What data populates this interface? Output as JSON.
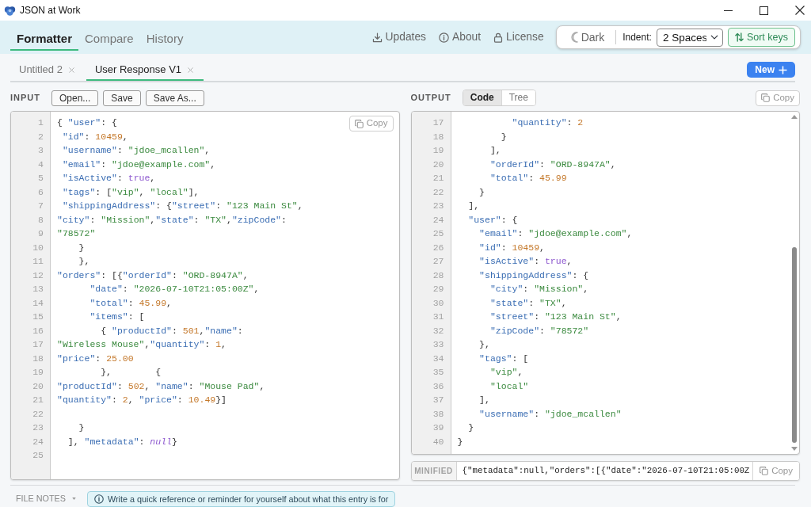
{
  "window": {
    "title": "JSON at Work"
  },
  "nav": {
    "tabs": [
      {
        "label": "Formatter",
        "selected": true
      },
      {
        "label": "Compare",
        "selected": false
      },
      {
        "label": "History",
        "selected": false
      }
    ],
    "links": [
      {
        "label": "Updates"
      },
      {
        "label": "About"
      },
      {
        "label": "License"
      }
    ]
  },
  "settings": {
    "theme_button": "Dark",
    "indent": {
      "label": "Indent:",
      "value": "2 Spaces"
    },
    "sort_keys": {
      "label": "Sort keys",
      "on": true
    }
  },
  "documents": {
    "tabs": [
      {
        "label": "Untitled 2",
        "selected": false
      },
      {
        "label": "User Response V1",
        "selected": true
      }
    ],
    "new_button": "New"
  },
  "input": {
    "label": "INPUT",
    "buttons": [
      "Open...",
      "Save",
      "Save As..."
    ],
    "copy_button": "Copy",
    "lines": [
      {
        "no": "1",
        "tokens": [
          {
            "kind": "punct",
            "text": "{ "
          },
          {
            "kind": "key",
            "text": "\"user\""
          },
          {
            "kind": "punct",
            "text": ": {"
          }
        ]
      },
      {
        "no": "2",
        "tokens": [
          {
            "kind": "key",
            "text": " \"id\""
          },
          {
            "kind": "punct",
            "text": ": "
          },
          {
            "kind": "number",
            "text": "10459"
          },
          {
            "kind": "punct",
            "text": ","
          }
        ]
      },
      {
        "no": "3",
        "tokens": [
          {
            "kind": "key",
            "text": " \"username\""
          },
          {
            "kind": "punct",
            "text": ": "
          },
          {
            "kind": "string",
            "text": "\"jdoe_mcallen\""
          },
          {
            "kind": "punct",
            "text": ","
          }
        ]
      },
      {
        "no": "4",
        "tokens": [
          {
            "kind": "key",
            "text": " \"email\""
          },
          {
            "kind": "punct",
            "text": ": "
          },
          {
            "kind": "string",
            "text": "\"jdoe@example.com\""
          },
          {
            "kind": "punct",
            "text": ","
          }
        ]
      },
      {
        "no": "5",
        "tokens": [
          {
            "kind": "key",
            "text": " \"isActive\""
          },
          {
            "kind": "punct",
            "text": ": "
          },
          {
            "kind": "bool",
            "text": "true"
          },
          {
            "kind": "punct",
            "text": ","
          }
        ]
      },
      {
        "no": "6",
        "tokens": [
          {
            "kind": "key",
            "text": " \"tags\""
          },
          {
            "kind": "punct",
            "text": ": ["
          },
          {
            "kind": "string",
            "text": "\"vip\""
          },
          {
            "kind": "punct",
            "text": ", "
          },
          {
            "kind": "string",
            "text": "\"local\""
          },
          {
            "kind": "punct",
            "text": "],"
          }
        ]
      },
      {
        "no": "7",
        "tokens": [
          {
            "kind": "key",
            "text": " \"shippingAddress\""
          },
          {
            "kind": "punct",
            "text": ": {"
          },
          {
            "kind": "key",
            "text": "\"street\""
          },
          {
            "kind": "punct",
            "text": ": "
          },
          {
            "kind": "string",
            "text": "\"123 Main St\""
          },
          {
            "kind": "punct",
            "text": ","
          }
        ]
      },
      {
        "no": "8",
        "tokens": [
          {
            "kind": "key",
            "text": "\"city\""
          },
          {
            "kind": "punct",
            "text": ": "
          },
          {
            "kind": "string",
            "text": "\"Mission\""
          },
          {
            "kind": "punct",
            "text": ","
          },
          {
            "kind": "key",
            "text": "\"state\""
          },
          {
            "kind": "punct",
            "text": ": "
          },
          {
            "kind": "string",
            "text": "\"TX\""
          },
          {
            "kind": "punct",
            "text": ","
          },
          {
            "kind": "key",
            "text": "\"zipCode\""
          },
          {
            "kind": "punct",
            "text": ":"
          }
        ]
      },
      {
        "no": "9",
        "tokens": [
          {
            "kind": "string",
            "text": "\"78572\""
          }
        ]
      },
      {
        "no": "10",
        "tokens": [
          {
            "kind": "punct",
            "text": "    }"
          }
        ]
      },
      {
        "no": "11",
        "tokens": [
          {
            "kind": "punct",
            "text": "    },"
          }
        ]
      },
      {
        "no": "12",
        "tokens": [
          {
            "kind": "key",
            "text": "\"orders\""
          },
          {
            "kind": "punct",
            "text": ": [{"
          },
          {
            "kind": "key",
            "text": "\"orderId\""
          },
          {
            "kind": "punct",
            "text": ": "
          },
          {
            "kind": "string",
            "text": "\"ORD-8947A\""
          },
          {
            "kind": "punct",
            "text": ","
          }
        ]
      },
      {
        "no": "13",
        "tokens": [
          {
            "kind": "key",
            "text": "      \"date\""
          },
          {
            "kind": "punct",
            "text": ": "
          },
          {
            "kind": "string",
            "text": "\"2026-07-10T21:05:00Z\""
          },
          {
            "kind": "punct",
            "text": ","
          }
        ]
      },
      {
        "no": "14",
        "tokens": [
          {
            "kind": "key",
            "text": "      \"total\""
          },
          {
            "kind": "punct",
            "text": ": "
          },
          {
            "kind": "number",
            "text": "45.99"
          },
          {
            "kind": "punct",
            "text": ","
          }
        ]
      },
      {
        "no": "15",
        "tokens": [
          {
            "kind": "key",
            "text": "      \"items\""
          },
          {
            "kind": "punct",
            "text": ": ["
          }
        ]
      },
      {
        "no": "16",
        "tokens": [
          {
            "kind": "punct",
            "text": "        { "
          },
          {
            "kind": "key",
            "text": "\"productId\""
          },
          {
            "kind": "punct",
            "text": ": "
          },
          {
            "kind": "number",
            "text": "501"
          },
          {
            "kind": "punct",
            "text": ","
          },
          {
            "kind": "key",
            "text": "\"name\""
          },
          {
            "kind": "punct",
            "text": ":"
          }
        ]
      },
      {
        "no": "17",
        "tokens": [
          {
            "kind": "string",
            "text": "\"Wireless Mouse\""
          },
          {
            "kind": "punct",
            "text": ","
          },
          {
            "kind": "key",
            "text": "\"quantity\""
          },
          {
            "kind": "punct",
            "text": ": "
          },
          {
            "kind": "number",
            "text": "1"
          },
          {
            "kind": "punct",
            "text": ","
          }
        ]
      },
      {
        "no": "18",
        "tokens": [
          {
            "kind": "key",
            "text": "\"price\""
          },
          {
            "kind": "punct",
            "text": ": "
          },
          {
            "kind": "number",
            "text": "25.00"
          }
        ]
      },
      {
        "no": "19",
        "tokens": [
          {
            "kind": "punct",
            "text": "        },        {"
          }
        ]
      },
      {
        "no": "20",
        "tokens": [
          {
            "kind": "key",
            "text": "\"productId\""
          },
          {
            "kind": "punct",
            "text": ": "
          },
          {
            "kind": "number",
            "text": "502"
          },
          {
            "kind": "punct",
            "text": ", "
          },
          {
            "kind": "key",
            "text": "\"name\""
          },
          {
            "kind": "punct",
            "text": ": "
          },
          {
            "kind": "string",
            "text": "\"Mouse Pad\""
          },
          {
            "kind": "punct",
            "text": ","
          }
        ]
      },
      {
        "no": "21",
        "tokens": [
          {
            "kind": "key",
            "text": "\"quantity\""
          },
          {
            "kind": "punct",
            "text": ": "
          },
          {
            "kind": "number",
            "text": "2"
          },
          {
            "kind": "punct",
            "text": ", "
          },
          {
            "kind": "key",
            "text": "\"price\""
          },
          {
            "kind": "punct",
            "text": ": "
          },
          {
            "kind": "number",
            "text": "10.49"
          },
          {
            "kind": "punct",
            "text": "}]"
          }
        ]
      },
      {
        "no": "22"
      },
      {
        "no": "23",
        "tokens": [
          {
            "kind": "punct",
            "text": "    }"
          }
        ]
      },
      {
        "no": "24",
        "tokens": [
          {
            "kind": "punct",
            "text": "  ], "
          },
          {
            "kind": "key",
            "text": "\"metadata\""
          },
          {
            "kind": "punct",
            "text": ": "
          },
          {
            "kind": "null",
            "text": "null"
          },
          {
            "kind": "punct",
            "text": "}"
          }
        ]
      },
      {
        "no": "25"
      }
    ]
  },
  "output": {
    "label": "OUTPUT",
    "view_tabs": [
      {
        "label": "Code",
        "selected": true
      },
      {
        "label": "Tree",
        "selected": false
      }
    ],
    "copy_button": "Copy",
    "lines": [
      {
        "no": "17",
        "tokens": [
          {
            "kind": "key",
            "text": "          \"quantity\""
          },
          {
            "kind": "punct",
            "text": ": "
          },
          {
            "kind": "number",
            "text": "2"
          }
        ]
      },
      {
        "no": "18",
        "tokens": [
          {
            "kind": "punct",
            "text": "        }"
          }
        ]
      },
      {
        "no": "19",
        "tokens": [
          {
            "kind": "punct",
            "text": "      ],"
          }
        ]
      },
      {
        "no": "20",
        "tokens": [
          {
            "kind": "key",
            "text": "      \"orderId\""
          },
          {
            "kind": "punct",
            "text": ": "
          },
          {
            "kind": "string",
            "text": "\"ORD-8947A\""
          },
          {
            "kind": "punct",
            "text": ","
          }
        ]
      },
      {
        "no": "21",
        "tokens": [
          {
            "kind": "key",
            "text": "      \"total\""
          },
          {
            "kind": "punct",
            "text": ": "
          },
          {
            "kind": "number",
            "text": "45.99"
          }
        ]
      },
      {
        "no": "22",
        "tokens": [
          {
            "kind": "punct",
            "text": "    }"
          }
        ]
      },
      {
        "no": "23",
        "tokens": [
          {
            "kind": "punct",
            "text": "  ],"
          }
        ]
      },
      {
        "no": "24",
        "tokens": [
          {
            "kind": "key",
            "text": "  \"user\""
          },
          {
            "kind": "punct",
            "text": ": {"
          }
        ]
      },
      {
        "no": "25",
        "tokens": [
          {
            "kind": "key",
            "text": "    \"email\""
          },
          {
            "kind": "punct",
            "text": ": "
          },
          {
            "kind": "string",
            "text": "\"jdoe@example.com\""
          },
          {
            "kind": "punct",
            "text": ","
          }
        ]
      },
      {
        "no": "26",
        "tokens": [
          {
            "kind": "key",
            "text": "    \"id\""
          },
          {
            "kind": "punct",
            "text": ": "
          },
          {
            "kind": "number",
            "text": "10459"
          },
          {
            "kind": "punct",
            "text": ","
          }
        ]
      },
      {
        "no": "27",
        "tokens": [
          {
            "kind": "key",
            "text": "    \"isActive\""
          },
          {
            "kind": "punct",
            "text": ": "
          },
          {
            "kind": "bool",
            "text": "true"
          },
          {
            "kind": "punct",
            "text": ","
          }
        ]
      },
      {
        "no": "28",
        "tokens": [
          {
            "kind": "key",
            "text": "    \"shippingAddress\""
          },
          {
            "kind": "punct",
            "text": ": {"
          }
        ]
      },
      {
        "no": "29",
        "tokens": [
          {
            "kind": "key",
            "text": "      \"city\""
          },
          {
            "kind": "punct",
            "text": ": "
          },
          {
            "kind": "string",
            "text": "\"Mission\""
          },
          {
            "kind": "punct",
            "text": ","
          }
        ]
      },
      {
        "no": "30",
        "tokens": [
          {
            "kind": "key",
            "text": "      \"state\""
          },
          {
            "kind": "punct",
            "text": ": "
          },
          {
            "kind": "string",
            "text": "\"TX\""
          },
          {
            "kind": "punct",
            "text": ","
          }
        ]
      },
      {
        "no": "31",
        "tokens": [
          {
            "kind": "key",
            "text": "      \"street\""
          },
          {
            "kind": "punct",
            "text": ": "
          },
          {
            "kind": "string",
            "text": "\"123 Main St\""
          },
          {
            "kind": "punct",
            "text": ","
          }
        ]
      },
      {
        "no": "32",
        "tokens": [
          {
            "kind": "key",
            "text": "      \"zipCode\""
          },
          {
            "kind": "punct",
            "text": ": "
          },
          {
            "kind": "string",
            "text": "\"78572\""
          }
        ]
      },
      {
        "no": "33",
        "tokens": [
          {
            "kind": "punct",
            "text": "    },"
          }
        ]
      },
      {
        "no": "34",
        "tokens": [
          {
            "kind": "key",
            "text": "    \"tags\""
          },
          {
            "kind": "punct",
            "text": ": ["
          }
        ]
      },
      {
        "no": "35",
        "tokens": [
          {
            "kind": "string",
            "text": "      \"vip\""
          },
          {
            "kind": "punct",
            "text": ","
          }
        ]
      },
      {
        "no": "36",
        "tokens": [
          {
            "kind": "string",
            "text": "      \"local\""
          }
        ]
      },
      {
        "no": "37",
        "tokens": [
          {
            "kind": "punct",
            "text": "    ],"
          }
        ]
      },
      {
        "no": "38",
        "tokens": [
          {
            "kind": "key",
            "text": "    \"username\""
          },
          {
            "kind": "punct",
            "text": ": "
          },
          {
            "kind": "string",
            "text": "\"jdoe_mcallen\""
          }
        ]
      },
      {
        "no": "39",
        "tokens": [
          {
            "kind": "punct",
            "text": "  }"
          }
        ]
      },
      {
        "no": "40",
        "tokens": [
          {
            "kind": "punct",
            "text": "}"
          }
        ]
      }
    ],
    "minified": {
      "label": "MINIFIED",
      "text": "{\"metadata\":null,\"orders\":[{\"date\":\"2026-07-10T21:05:00Z",
      "copy_button": "Copy"
    }
  },
  "file_notes": {
    "label": "FILE NOTES",
    "hint": "Write a quick reference or reminder for yourself about what this entry is for"
  }
}
